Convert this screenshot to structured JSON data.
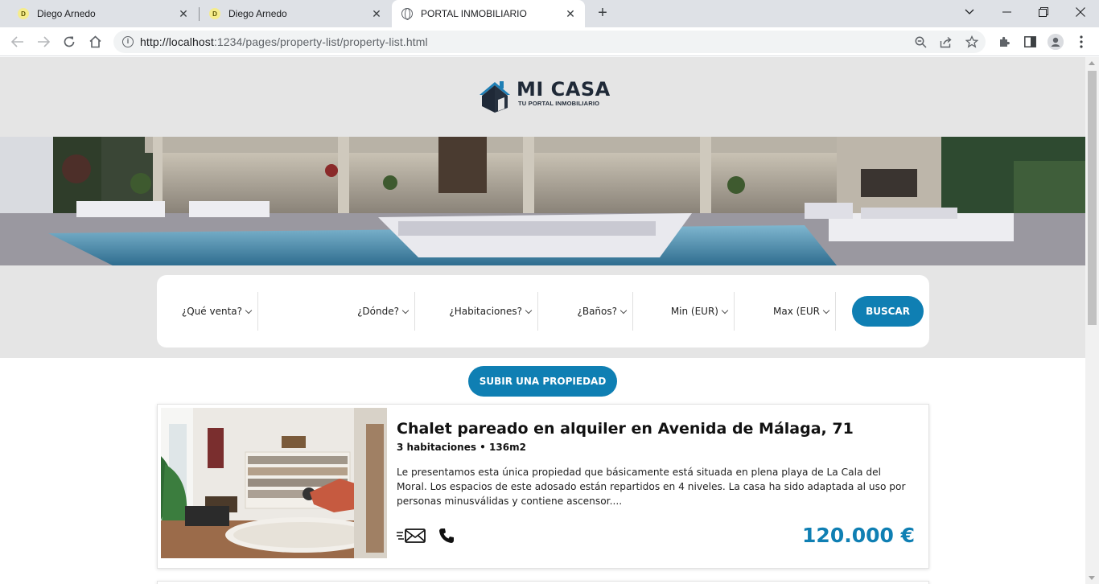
{
  "browser": {
    "tabs": [
      {
        "title": "Diego Arnedo",
        "favicon_letter": "D",
        "active": false
      },
      {
        "title": "Diego Arnedo",
        "favicon_letter": "D",
        "active": false
      },
      {
        "title": "PORTAL INMOBILIARIO",
        "favicon_icon": "globe-icon",
        "active": true
      }
    ],
    "url_host": "http://localhost",
    "url_rest": ":1234/pages/property-list/property-list.html"
  },
  "logo": {
    "title": "MI CASA",
    "subtitle": "TU PORTAL INMOBILIARIO"
  },
  "search": {
    "fields": [
      "¿Qué venta?",
      "¿Dónde?",
      "¿Habitaciones?",
      "¿Baños?",
      "Min (EUR)",
      "Max (EUR"
    ],
    "button_label": "BUSCAR"
  },
  "upload_button_label": "SUBIR UNA PROPIEDAD",
  "listing": {
    "title": "Chalet pareado en alquiler en Avenida de Málaga, 71",
    "meta": "3 habitaciones • 136m2",
    "description": "Le presentamos esta única propiedad que básicamente está situada en plena playa de La Cala del Moral. Los espacios de este adosado están repartidos en 4 niveles. La casa ha sido adaptada al uso por personas minusválidas y contiene ascensor....",
    "price": "120.000 €"
  },
  "colors": {
    "accent": "#0f7fb3",
    "band": "#e5e5e5"
  }
}
